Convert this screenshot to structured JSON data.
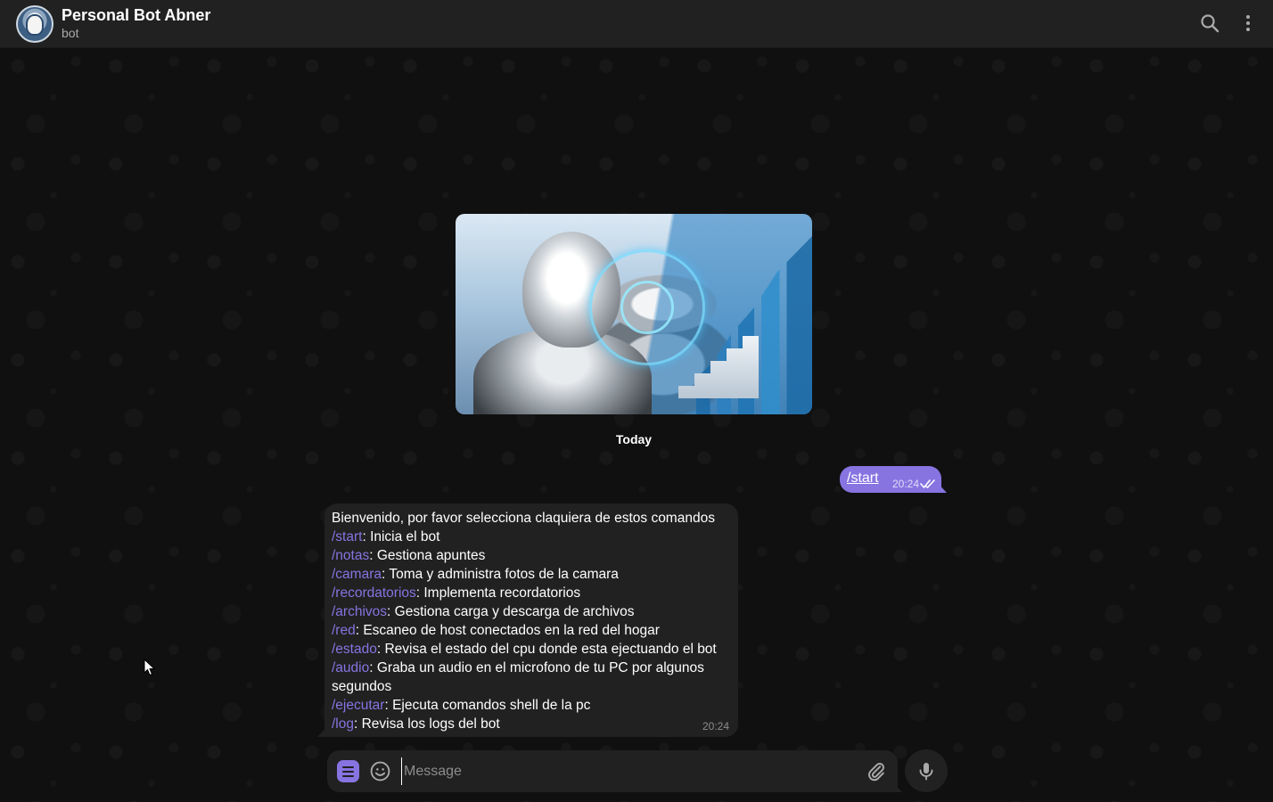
{
  "header": {
    "title": "Personal Bot Abner",
    "subtitle": "bot",
    "icons": [
      "search-icon",
      "more-vertical-icon"
    ]
  },
  "chat": {
    "date_separator": "Today",
    "outgoing": {
      "text": "/start",
      "time": "20:24",
      "status_icon": "double-check-icon"
    },
    "incoming": {
      "intro": "Bienvenido, por favor selecciona claquiera de estos comandos",
      "commands": [
        {
          "cmd": "/start",
          "desc": ": Inicia el bot"
        },
        {
          "cmd": "/notas",
          "desc": ": Gestiona apuntes"
        },
        {
          "cmd": "/camara",
          "desc": ": Toma y administra fotos de la camara"
        },
        {
          "cmd": "/recordatorios",
          "desc": ": Implementa recordatorios"
        },
        {
          "cmd": "/archivos",
          "desc": ": Gestiona carga y descarga de archivos"
        },
        {
          "cmd": "/red",
          "desc": ": Escaneo de host conectados en la red del hogar"
        },
        {
          "cmd": "/estado",
          "desc": ": Revisa el estado del cpu donde esta ejectuando el bot"
        },
        {
          "cmd": "/audio",
          "desc": ": Graba un audio en el microfono de tu PC por algunos segundos"
        },
        {
          "cmd": "/ejecutar",
          "desc": ": Ejecuta comandos shell de la pc"
        },
        {
          "cmd": "/log",
          "desc": ": Revisa los logs del bot"
        }
      ],
      "time": "20:24"
    }
  },
  "composer": {
    "placeholder": "Message",
    "value": "",
    "icons": [
      "bot-menu-icon",
      "emoji-icon",
      "attach-icon",
      "microphone-icon"
    ]
  },
  "colors": {
    "accent": "#8774e1",
    "header_bg": "#212121",
    "bubble_bg": "#212121",
    "chat_bg": "#101010",
    "secondary_text": "#aaaaaa"
  }
}
